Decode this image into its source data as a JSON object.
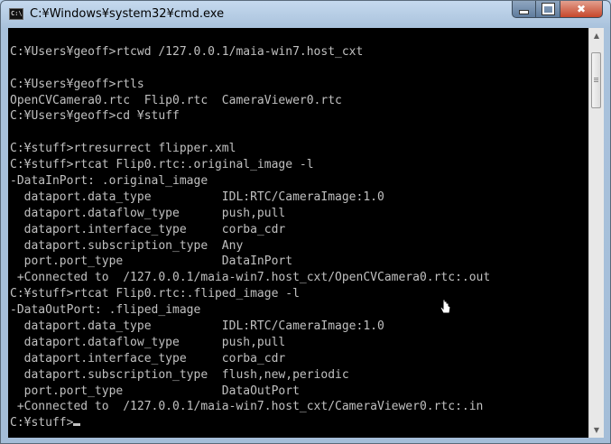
{
  "window": {
    "title": "C:¥Windows¥system32¥cmd.exe",
    "icon": "cmd-icon"
  },
  "caption_buttons": {
    "minimize": "minimize-icon",
    "maximize": "maximize-icon",
    "close": "✖"
  },
  "console": {
    "lines": [
      "",
      "C:¥Users¥geoff>rtcwd /127.0.0.1/maia-win7.host_cxt",
      "",
      "C:¥Users¥geoff>rtls",
      "OpenCVCamera0.rtc  Flip0.rtc  CameraViewer0.rtc",
      "C:¥Users¥geoff>cd ¥stuff",
      "",
      "C:¥stuff>rtresurrect flipper.xml",
      "C:¥stuff>rtcat Flip0.rtc:.original_image -l",
      "-DataInPort: .original_image",
      "  dataport.data_type          IDL:RTC/CameraImage:1.0",
      "  dataport.dataflow_type      push,pull",
      "  dataport.interface_type     corba_cdr",
      "  dataport.subscription_type  Any",
      "  port.port_type              DataInPort",
      " +Connected to  /127.0.0.1/maia-win7.host_cxt/OpenCVCamera0.rtc:.out",
      "C:¥stuff>rtcat Flip0.rtc:.fliped_image -l",
      "-DataOutPort: .fliped_image",
      "  dataport.data_type          IDL:RTC/CameraImage:1.0",
      "  dataport.dataflow_type      push,pull",
      "  dataport.interface_type     corba_cdr",
      "  dataport.subscription_type  flush,new,periodic",
      "  port.port_type              DataOutPort",
      " +Connected to  /127.0.0.1/maia-win7.host_cxt/CameraViewer0.rtc:.in"
    ],
    "prompt": "C:¥stuff>"
  },
  "scrollbar": {
    "up": "▲",
    "down": "▼"
  },
  "colors": {
    "console_bg": "#000000",
    "console_fg": "#c0c0c0",
    "titlebar": "#b9d1ea",
    "close_button": "#c6472b"
  }
}
